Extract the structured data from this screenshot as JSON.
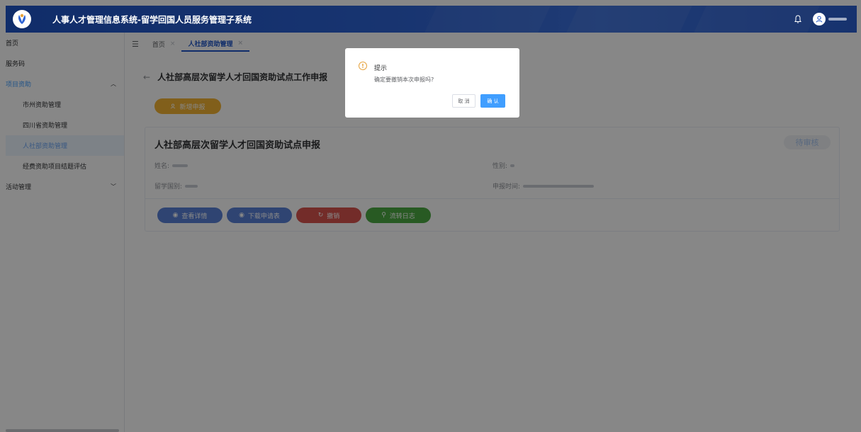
{
  "header": {
    "title": "人事人才管理信息系统-留学回国人员服务管理子系统",
    "brand_color": "#1f55c8"
  },
  "sidebar": {
    "items": [
      {
        "label": "首页"
      },
      {
        "label": "服务码"
      },
      {
        "label": "项目资助",
        "expanded": true
      },
      {
        "label": "市州资助管理"
      },
      {
        "label": "四川省资助管理"
      },
      {
        "label": "人社部资助管理",
        "selected": true
      },
      {
        "label": "经费资助项目结题评估"
      },
      {
        "label": "活动管理",
        "expanded": false
      }
    ]
  },
  "tabs": [
    {
      "label": "首页",
      "close": "×"
    },
    {
      "label": "人社部资助管理",
      "close": "×",
      "active": true
    }
  ],
  "page": {
    "back_icon": "←",
    "title": "人社部高层次留学人才回国资助试点工作申报",
    "add_button": "新增申报"
  },
  "card": {
    "title": "人社部高层次留学人才回国资助试点申报",
    "status": "待审核",
    "fields": {
      "name_label": "姓名:",
      "gender_label": "性别:",
      "country_label": "留学国别:",
      "date_label": "申报时间:"
    },
    "actions": {
      "view": "查看详情",
      "download": "下载申请表",
      "revoke": "撤销",
      "log": "流转日志"
    }
  },
  "dialog": {
    "icon": "!",
    "title": "提示",
    "message": "确定要撤销本次申报吗?",
    "cancel": "取 消",
    "confirm": "确 认"
  }
}
